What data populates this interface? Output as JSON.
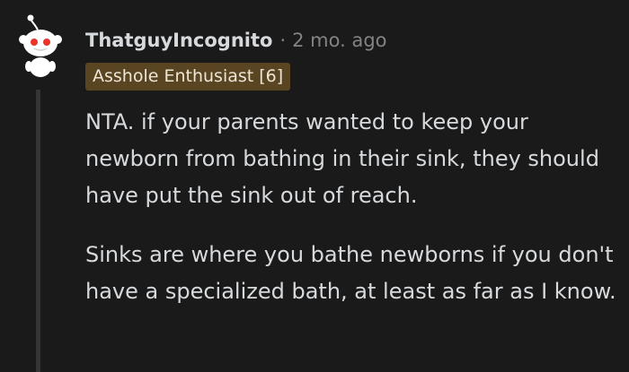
{
  "comment": {
    "author": "ThatguyIncognito",
    "separator": "·",
    "timestamp": "2 mo. ago",
    "flair": "Asshole Enthusiast [6]",
    "avatar_icon": "snoo-avatar-icon",
    "paragraphs": [
      "NTA. if your parents wanted to keep your newborn from bathing in their sink, they should have put the sink out of reach.",
      "Sinks are where you bathe newborns if you don't have a specialized bath, at least as far as I know."
    ]
  },
  "colors": {
    "background": "#1a1a1b",
    "text": "#d7dadc",
    "muted": "#818384",
    "flair_bg": "#5a4523",
    "thread_line": "#343536",
    "avatar_eye": "#e8342a"
  }
}
